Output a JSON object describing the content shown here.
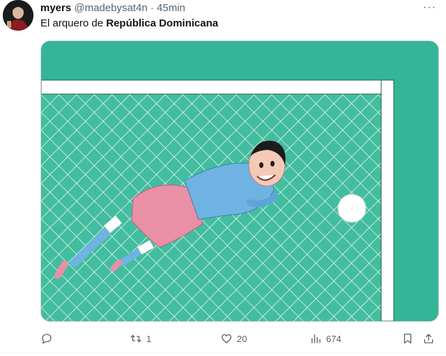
{
  "tweet": {
    "display_name": "myers",
    "handle": "@madebysat4n",
    "separator": "·",
    "time": "45min",
    "more": "···",
    "text_plain": "El arquero de ",
    "text_bold": "República Dominicana"
  },
  "media": {
    "description_icon": "illustration-goalkeeper",
    "colors": {
      "pitch": "#34b496",
      "net_fill": "#46bfa1",
      "post": "#ffffff",
      "shirt": "#6fb3e3",
      "shorts": "#e98fa6"
    }
  },
  "actions": {
    "reply": {
      "icon": "reply-icon",
      "count": ""
    },
    "retweet": {
      "icon": "retweet-icon",
      "count": "1"
    },
    "like": {
      "icon": "heart-icon",
      "count": "20"
    },
    "views": {
      "icon": "views-icon",
      "count": "674"
    },
    "bookmark": {
      "icon": "bookmark-icon"
    },
    "share": {
      "icon": "share-icon"
    }
  }
}
